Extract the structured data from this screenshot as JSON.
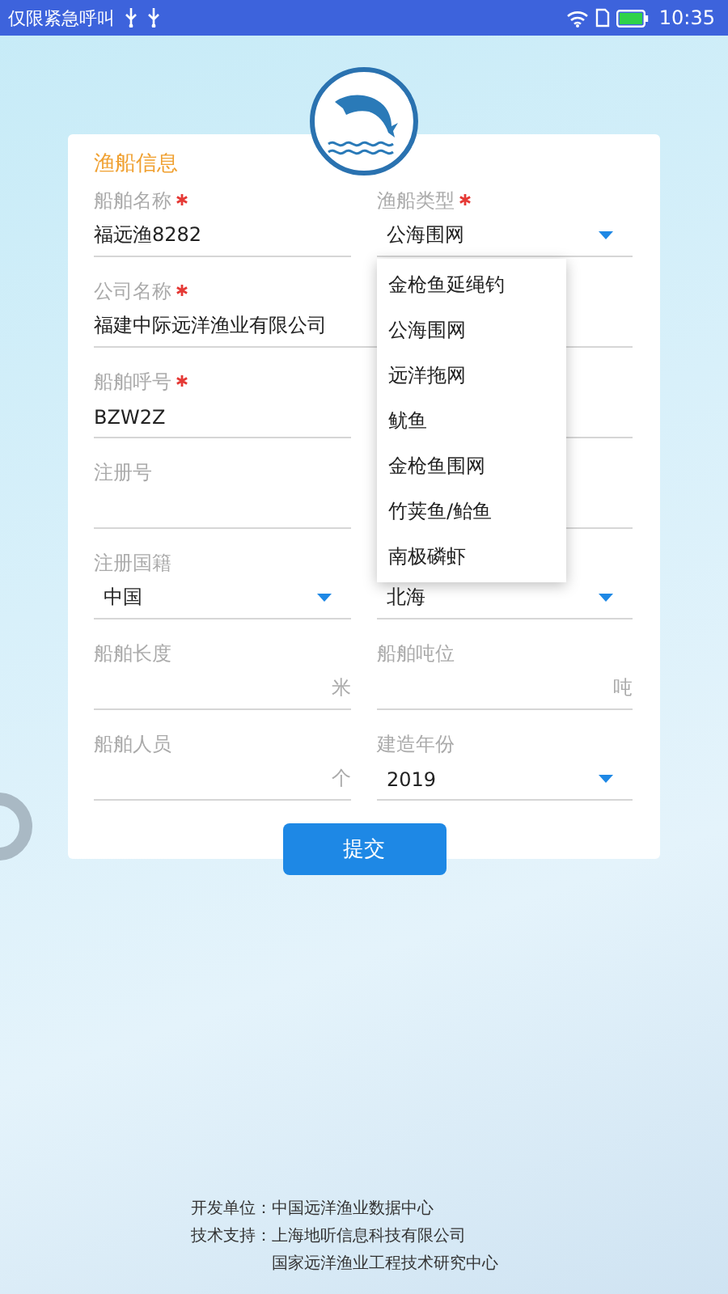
{
  "status_bar": {
    "carrier": "仅限紧急呼叫",
    "time": "10:35"
  },
  "card": {
    "title": "渔船信息",
    "fields": [
      {
        "kind": "text",
        "label": "船舶名称",
        "required": true,
        "value": "福远渔8282"
      },
      {
        "kind": "select",
        "label": "渔船类型",
        "required": true,
        "value": "公海围网"
      },
      {
        "kind": "wide",
        "label": "公司名称",
        "required": true,
        "value": "福建中际远洋渔业有限公司"
      },
      {
        "kind": "text",
        "label": "船舶呼号",
        "required": true,
        "value": "BZW2Z"
      },
      {
        "kind": "blank"
      },
      {
        "kind": "text",
        "label": "注册号"
      },
      {
        "kind": "blank"
      },
      {
        "kind": "select",
        "label": "注册国籍",
        "value": "中国"
      },
      {
        "kind": "select",
        "value": "北海"
      },
      {
        "kind": "unit",
        "label": "船舶长度",
        "unit": "米"
      },
      {
        "kind": "unit",
        "label": "船舶吨位",
        "unit": "吨"
      },
      {
        "kind": "unit",
        "label": "船舶人员",
        "unit": "个"
      },
      {
        "kind": "select",
        "label": "建造年份",
        "value": "2019"
      }
    ],
    "submit": "提交",
    "dropdown": [
      "金枪鱼延绳钓",
      "公海围网",
      "远洋拖网",
      "鱿鱼",
      "金枪鱼围网",
      "竹荚鱼/鲐鱼",
      "南极磷虾"
    ]
  },
  "footer": [
    {
      "label": "开发单位：",
      "lines": [
        "中国远洋渔业数据中心"
      ]
    },
    {
      "label": "技术支持：",
      "lines": [
        "上海地听信息科技有限公司",
        "国家远洋渔业工程技术研究中心"
      ]
    }
  ]
}
